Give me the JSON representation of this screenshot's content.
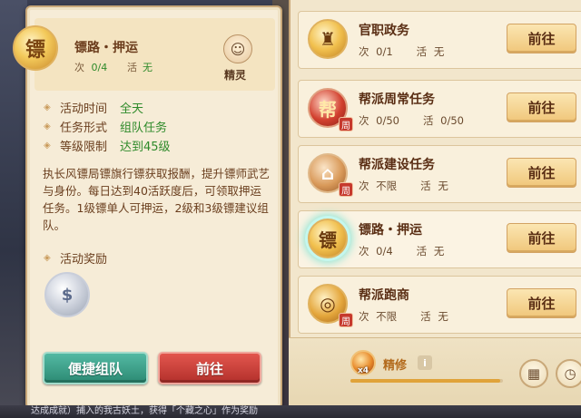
{
  "detail": {
    "title": "镖路・押运",
    "count_label": "次",
    "count_value": "0/4",
    "huo_label": "活",
    "huo_value": "无",
    "spirit_label": "精灵",
    "info": [
      {
        "label": "活动时间",
        "value": "全天"
      },
      {
        "label": "任务形式",
        "value": "组队任务"
      },
      {
        "label": "等级限制",
        "value": "达到45级"
      }
    ],
    "description": "执长风镖局镖旗行镖获取报酬，提升镖师武艺与身份。每日达到40活跃度后，可领取押运任务。1级镖单人可押运，2级和3级镖建议组队。",
    "reward_title": "活动奖励",
    "team_button": "便捷组队",
    "go_button": "前往"
  },
  "tasks": [
    {
      "name": "官职政务",
      "ci_label": "次",
      "ci_value": "0/1",
      "huo_label": "活",
      "huo_value": "无",
      "icon": "official-seal-icon",
      "go": "前往",
      "weekly": false
    },
    {
      "name": "帮派周常任务",
      "ci_label": "次",
      "ci_value": "0/50",
      "huo_label": "活",
      "huo_value": "0/50",
      "icon": "guild-banner-icon",
      "badge": "周",
      "emblem": "帮",
      "go": "前往",
      "weekly": true
    },
    {
      "name": "帮派建设任务",
      "ci_label": "次",
      "ci_value": "不限",
      "huo_label": "活",
      "huo_value": "无",
      "icon": "house-icon",
      "badge": "周",
      "go": "前往",
      "weekly": true
    },
    {
      "name": "镖路・押运",
      "ci_label": "次",
      "ci_value": "0/4",
      "huo_label": "活",
      "huo_value": "无",
      "icon": "escort-icon",
      "go": "前往",
      "weekly": false
    },
    {
      "name": "帮派跑商",
      "ci_label": "次",
      "ci_value": "不限",
      "huo_label": "活",
      "huo_value": "无",
      "icon": "coin-icon",
      "badge": "周",
      "go": "前往",
      "weekly": true
    }
  ],
  "bottom": {
    "jingxiu_label": "精修",
    "multiplier": "x4",
    "info": "i",
    "progress_fraction": 0.98
  },
  "ticker": "达成成就）捕入的我古妖土，获得「个藏之心」作为奖励"
}
